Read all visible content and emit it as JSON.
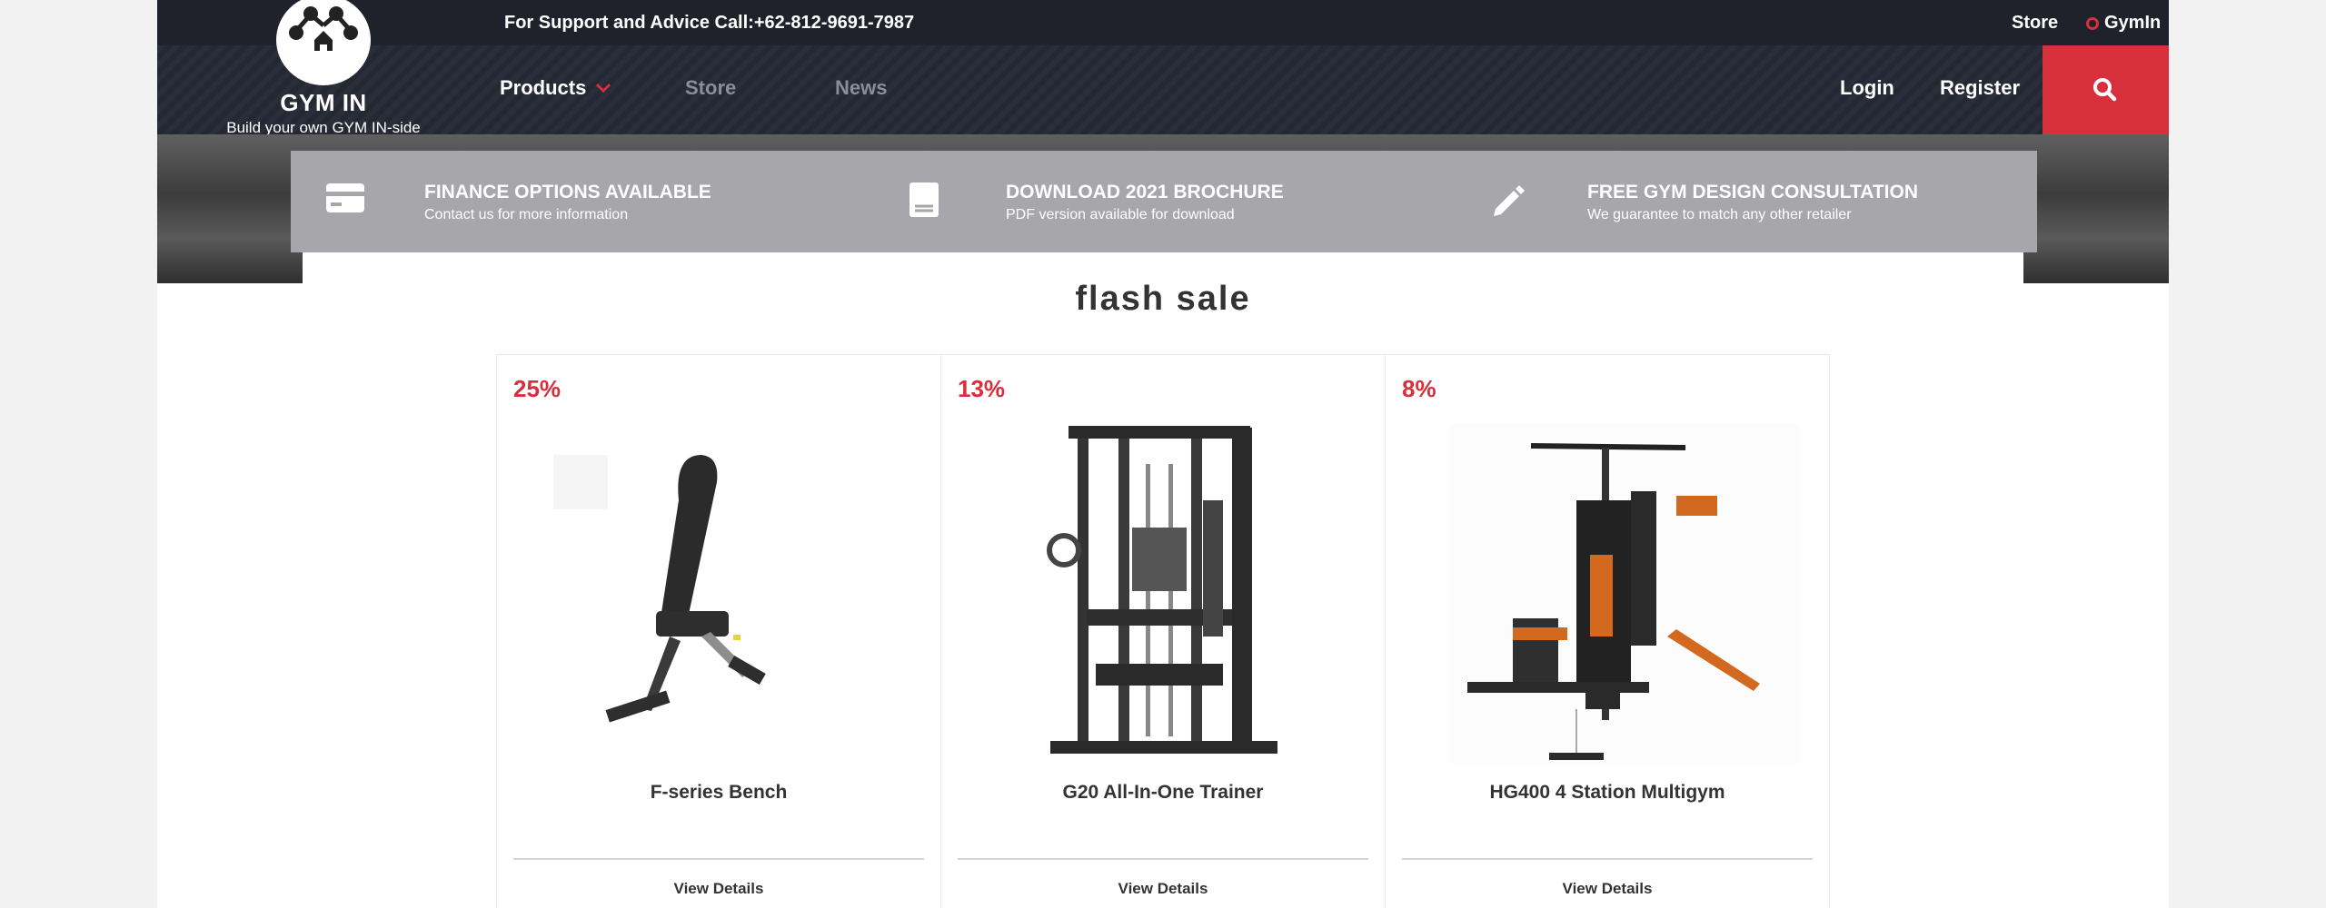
{
  "header": {
    "support_text": "For Support and Advice Call:+62-812-9691-7987",
    "top_store": "Store",
    "top_gymin": "GymIn",
    "logo_name": "GYM IN",
    "logo_tagline": "Build your own GYM IN-side",
    "nav": {
      "products": "Products",
      "store": "Store",
      "news": "News",
      "login": "Login",
      "register": "Register"
    },
    "accent_color": "#d72f3b"
  },
  "info_bar": [
    {
      "icon": "credit-card-icon",
      "title": "FINANCE OPTIONS AVAILABLE",
      "subtitle": "Contact us for more information"
    },
    {
      "icon": "book-icon",
      "title": "DOWNLOAD 2021 BROCHURE",
      "subtitle": "PDF version available for download"
    },
    {
      "icon": "pencil-icon",
      "title": "FREE GYM DESIGN CONSULTATION",
      "subtitle": "We guarantee to match any other retailer"
    }
  ],
  "flash_sale": {
    "title": "flash sale",
    "products": [
      {
        "discount": "25%",
        "name": "F-series Bench",
        "details_label": "View Details"
      },
      {
        "discount": "13%",
        "name": "G20 All-In-One Trainer",
        "details_label": "View Details"
      },
      {
        "discount": "8%",
        "name": "HG400 4 Station Multigym",
        "details_label": "View Details"
      }
    ]
  }
}
